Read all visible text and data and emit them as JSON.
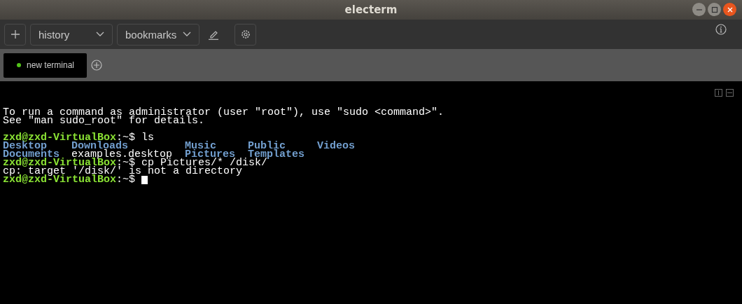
{
  "window": {
    "title": "electerm"
  },
  "toolbar": {
    "history": "history",
    "bookmarks": "bookmarks"
  },
  "tabs": [
    {
      "label": "new terminal",
      "selected": true,
      "color": "#52c41a"
    }
  ],
  "terminal": {
    "lines": [
      {
        "kind": "text",
        "segments": [
          {
            "kind": "plain",
            "text": "To run a command as administrator (user \"root\"), use \"sudo <command>\"."
          }
        ]
      },
      {
        "kind": "text",
        "segments": [
          {
            "kind": "plain",
            "text": "See \"man sudo_root\" for details."
          }
        ]
      },
      {
        "kind": "blank"
      },
      {
        "kind": "text",
        "segments": [
          {
            "kind": "prompt",
            "text": "zxd@zxd-VirtualBox"
          },
          {
            "kind": "plain",
            "text": ":~$ ls"
          }
        ]
      },
      {
        "kind": "listing",
        "entries": [
          {
            "kind": "dir",
            "text": "Desktop"
          },
          {
            "kind": "dir",
            "text": "Downloads"
          },
          {
            "kind": "dir",
            "text": "Music"
          },
          {
            "kind": "dir",
            "text": "Public"
          },
          {
            "kind": "dir",
            "text": "Videos"
          }
        ]
      },
      {
        "kind": "listing",
        "entries": [
          {
            "kind": "dir",
            "text": "Documents"
          },
          {
            "kind": "plain",
            "text": "examples.desktop"
          },
          {
            "kind": "dir",
            "text": "Pictures"
          },
          {
            "kind": "dir",
            "text": "Templates"
          }
        ]
      },
      {
        "kind": "text",
        "segments": [
          {
            "kind": "prompt",
            "text": "zxd@zxd-VirtualBox"
          },
          {
            "kind": "plain",
            "text": ":~$ cp Pictures/* /disk/"
          }
        ]
      },
      {
        "kind": "text",
        "segments": [
          {
            "kind": "plain",
            "text": "cp: target '/disk/' is not a directory"
          }
        ]
      },
      {
        "kind": "text",
        "cursor": true,
        "segments": [
          {
            "kind": "prompt",
            "text": "zxd@zxd-VirtualBox"
          },
          {
            "kind": "plain",
            "text": ":~$"
          }
        ]
      }
    ]
  }
}
